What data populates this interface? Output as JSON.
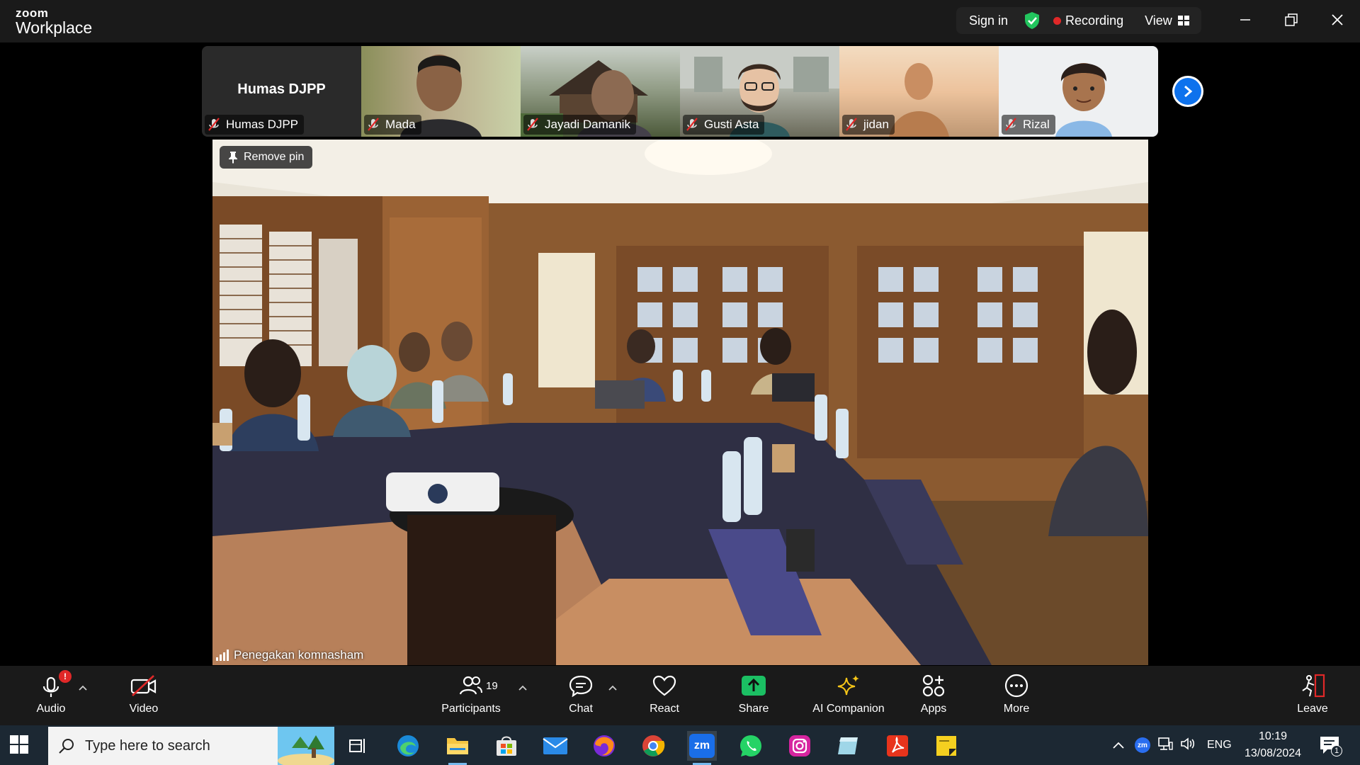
{
  "app": {
    "logo_small": "zoom",
    "logo_big": "Workplace",
    "sign_in": "Sign in",
    "recording": "Recording",
    "view": "View"
  },
  "thumbnails": [
    {
      "name": "Humas DJPP",
      "center_label": "Humas DJPP",
      "muted": true
    },
    {
      "name": "Mada",
      "muted": true
    },
    {
      "name": "Jayadi Damanik",
      "muted": true
    },
    {
      "name": "Gusti Asta",
      "muted": true
    },
    {
      "name": "jidan",
      "muted": true
    },
    {
      "name": "Rizal",
      "muted": true
    }
  ],
  "main_video": {
    "remove_pin": "Remove pin",
    "speaker": "Penegakan komnasham"
  },
  "toolbar": {
    "audio": "Audio",
    "audio_badge": "!",
    "video": "Video",
    "participants": "Participants",
    "participants_count": "19",
    "chat": "Chat",
    "react": "React",
    "share": "Share",
    "ai_companion": "AI Companion",
    "apps": "Apps",
    "more": "More",
    "leave": "Leave"
  },
  "taskbar": {
    "search_placeholder": "Type here to search",
    "lang": "ENG",
    "time": "10:19",
    "date": "13/08/2024",
    "notif_count": "1",
    "zoom_label": "zm"
  },
  "colors": {
    "accent_blue": "#0e72ed",
    "recording_red": "#e02828",
    "share_green": "#1bbf63",
    "secure_green": "#22c55e"
  }
}
